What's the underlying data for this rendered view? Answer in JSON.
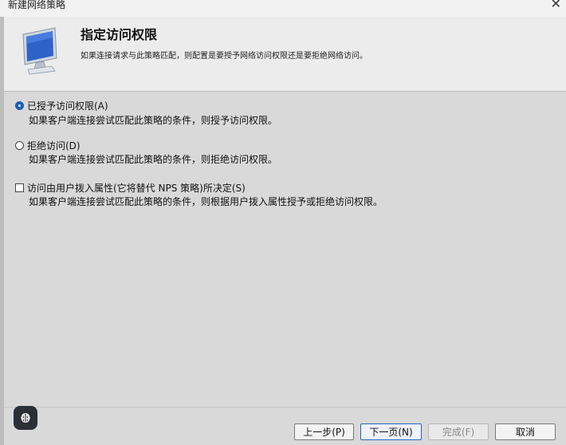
{
  "window": {
    "title": "新建网络策略",
    "close_glyph": "✕"
  },
  "header": {
    "heading": "指定访问权限",
    "description": "如果连接请求与此策略匹配，则配置是要授予网络访问权限还是要拒绝网络访问。",
    "icon": "computer-monitor-icon"
  },
  "options": [
    {
      "type": "radio",
      "label": "已授予访问权限(A)",
      "description": "如果客户端连接尝试匹配此策略的条件，则授予访问权限。",
      "selected": true
    },
    {
      "type": "radio",
      "label": "拒绝访问(D)",
      "description": "如果客户端连接尝试匹配此策略的条件，则拒绝访问权限。",
      "selected": false
    },
    {
      "type": "checkbox",
      "label": "访问由用户拨入属性(它将替代 NPS 策略)所决定(S)",
      "description": "如果客户端连接尝试匹配此策略的条件，则根据用户拨入属性授予或拒绝访问权限。",
      "checked": false
    }
  ],
  "buttons": {
    "back": "上一步(P)",
    "next": "下一页(N)",
    "finish": "完成(F)",
    "cancel": "取消"
  },
  "colors": {
    "accent": "#1a5fb4",
    "background": "#d9d9d9",
    "header_bg": "#ececec"
  }
}
